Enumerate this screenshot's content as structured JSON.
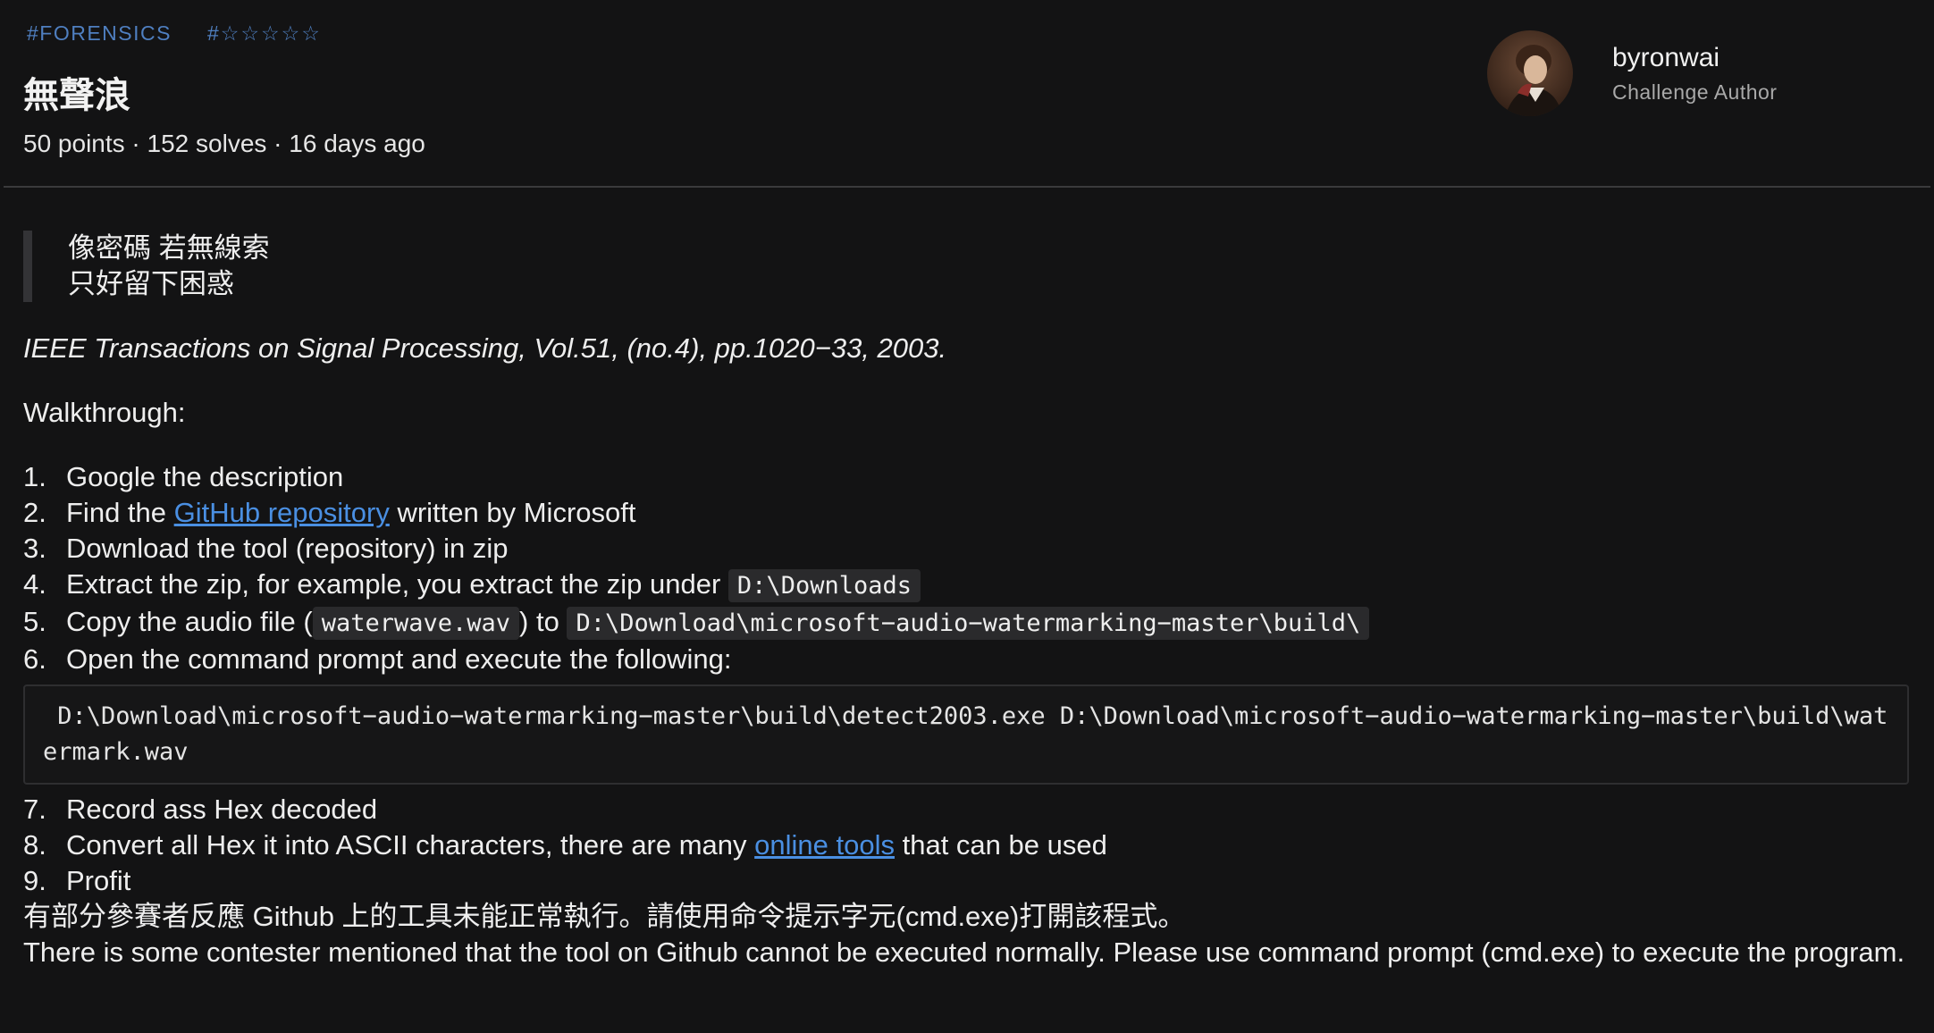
{
  "header": {
    "category_tag": "#FORENSICS",
    "difficulty_tag": "#☆☆☆☆☆",
    "title": "無聲浪",
    "meta": "50 points · 152 solves · 16 days ago"
  },
  "author": {
    "name": "byronwai",
    "role": "Challenge Author"
  },
  "description": {
    "quote_lines": [
      "像密碼 若無線索",
      "只好留下困惑"
    ],
    "citation": "IEEE Transactions on Signal Processing, Vol.51, (no.4), pp.1020−33, 2003.",
    "walkthrough_label": "Walkthrough:",
    "steps": {
      "s1": {
        "num": "1.",
        "text": "Google the description"
      },
      "s2": {
        "num": "2.",
        "before": "Find the ",
        "link": "GitHub repository",
        "after": " written by Microsoft"
      },
      "s3": {
        "num": "3.",
        "text": "Download the tool (repository) in zip"
      },
      "s4": {
        "num": "4.",
        "before": "Extract the zip, for example, you extract the zip under ",
        "code": "D:\\Downloads"
      },
      "s5": {
        "num": "5.",
        "before": "Copy the audio file (",
        "code1": "waterwave.wav",
        "middle": ") to ",
        "code2": "D:\\Download\\microsoft−audio−watermarking−master\\build\\"
      },
      "s6": {
        "num": "6.",
        "text": "Open the command prompt and execute the following:"
      },
      "s7": {
        "num": "7.",
        "text": "Record ass Hex decoded"
      },
      "s8": {
        "num": "8.",
        "before": "Convert all Hex it into ASCII characters, there are many ",
        "link": "online tools",
        "after": " that can be used"
      },
      "s9": {
        "num": "9.",
        "text": "Profit"
      }
    },
    "code_block": " D:\\Download\\microsoft−audio−watermarking−master\\build\\detect2003.exe D:\\Download\\microsoft−audio−watermarking−master\\build\\watermark.wav",
    "note_zh": "有部分參賽者反應 Github 上的工具未能正常執行。請使用命令提示字元(cmd.exe)打開該程式。",
    "note_en": "There is some contester mentioned that the tool on Github cannot be executed normally. Please use command prompt (cmd.exe) to execute the program."
  },
  "colors": {
    "background": "#131314",
    "tag": "#4f7fc0",
    "link": "#4a8fe2"
  }
}
